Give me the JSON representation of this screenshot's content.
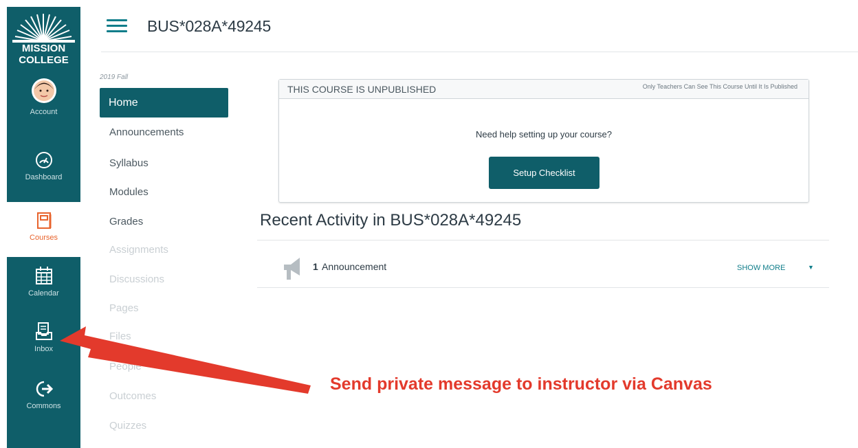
{
  "global_nav": {
    "logo_line1": "MISSION",
    "logo_line2": "COLLEGE",
    "items": [
      {
        "label": "Account",
        "icon": "avatar"
      },
      {
        "label": "Dashboard",
        "icon": "dashboard-icon"
      },
      {
        "label": "Courses",
        "icon": "courses-icon"
      },
      {
        "label": "Calendar",
        "icon": "calendar-icon"
      },
      {
        "label": "Inbox",
        "icon": "inbox-icon"
      },
      {
        "label": "Commons",
        "icon": "commons-icon"
      }
    ],
    "active_color": "#e8632c",
    "nav_color": "#0f5e69"
  },
  "header": {
    "course_title": "BUS*028A*49245"
  },
  "course_nav": {
    "term_label": "2019 Fall",
    "home": "Home",
    "items": [
      {
        "label": "Announcements",
        "enabled": true
      },
      {
        "label": "Syllabus",
        "enabled": true
      },
      {
        "label": "Modules",
        "enabled": true
      },
      {
        "label": "Grades",
        "enabled": true
      },
      {
        "label": "Assignments",
        "enabled": false
      },
      {
        "label": "Discussions",
        "enabled": false
      },
      {
        "label": "Pages",
        "enabled": false
      },
      {
        "label": "Files",
        "enabled": false
      },
      {
        "label": "People",
        "enabled": false
      },
      {
        "label": "Outcomes",
        "enabled": false
      },
      {
        "label": "Quizzes",
        "enabled": false
      }
    ]
  },
  "unpublished": {
    "title": "THIS COURSE IS UNPUBLISHED",
    "note": "Only Teachers Can See This Course Until It Is Published",
    "help": "Need help setting up your course?",
    "button": "Setup Checklist"
  },
  "recent_activity": {
    "heading": "Recent Activity in BUS*028A*49245",
    "count": "1",
    "label": "Announcement",
    "show_more": "SHOW MORE",
    "caret": "▼"
  },
  "annotation": {
    "text": "Send private message to instructor via Canvas",
    "color": "#e33a2c"
  }
}
